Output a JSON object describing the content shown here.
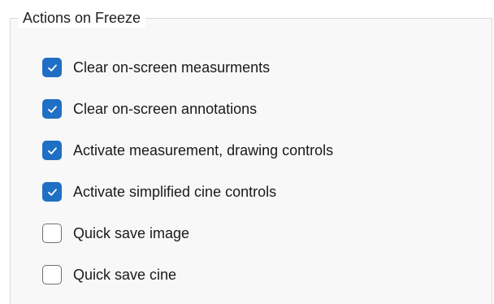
{
  "panel": {
    "title": "Actions on Freeze"
  },
  "options": [
    {
      "label": "Clear on-screen measurments",
      "checked": true
    },
    {
      "label": "Clear on-screen annotations",
      "checked": true
    },
    {
      "label": "Activate measurement, drawing controls",
      "checked": true
    },
    {
      "label": "Activate simplified cine controls",
      "checked": true
    },
    {
      "label": "Quick save image",
      "checked": false
    },
    {
      "label": "Quick save cine",
      "checked": false
    }
  ],
  "icons": {
    "checkmark": "check-icon"
  },
  "colors": {
    "checked_fill": "#1f6fc5",
    "unchecked_border": "#6f6f6f",
    "groupbox_border": "#d9d9d9"
  }
}
